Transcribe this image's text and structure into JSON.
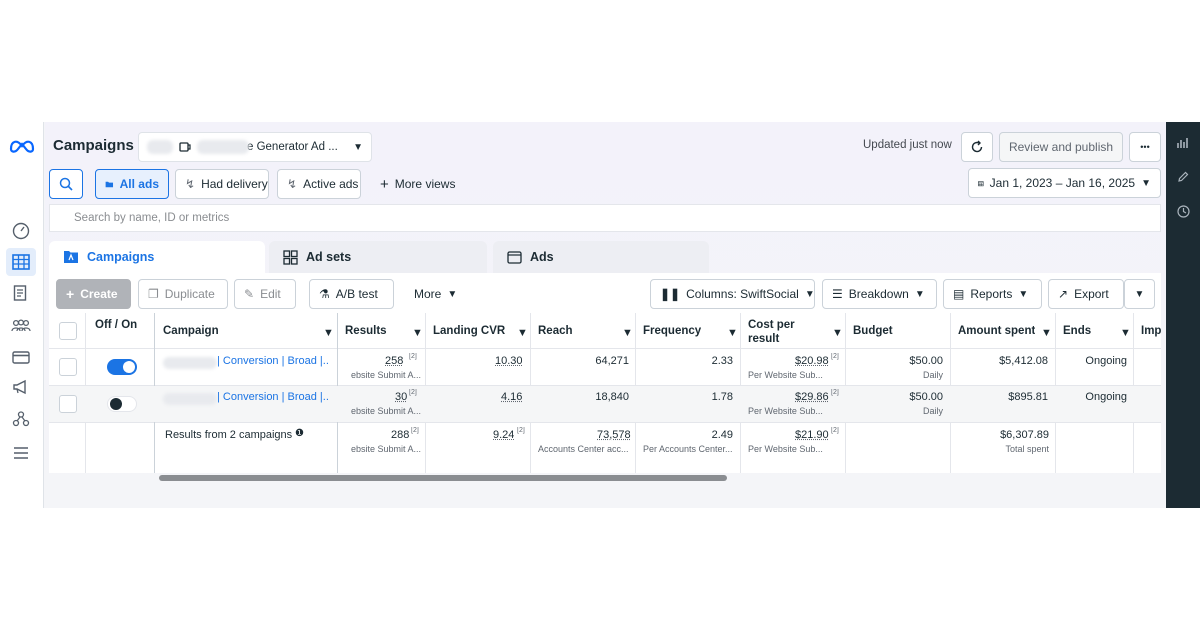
{
  "header": {
    "title": "Campaigns",
    "account_label": "e Generator Ad ...",
    "updated": "Updated just now",
    "review_publish": "Review and publish",
    "more": "•••"
  },
  "filters": {
    "all_ads": "All ads",
    "had_delivery": "Had delivery",
    "active_ads": "Active ads",
    "more_views": "More views",
    "date_range": "Jan 1, 2023 – Jan 16, 2025"
  },
  "search": {
    "placeholder": "Search by name, ID or metrics"
  },
  "level_tabs": [
    {
      "label": "Campaigns"
    },
    {
      "label": "Ad sets"
    },
    {
      "label": "Ads"
    }
  ],
  "toolbar": {
    "create": "Create",
    "duplicate": "Duplicate",
    "edit": "Edit",
    "ab_test": "A/B test",
    "more": "More",
    "columns": "Columns: SwiftSocial",
    "breakdown": "Breakdown",
    "reports": "Reports",
    "export": "Export"
  },
  "table": {
    "headers": {
      "offon": "Off / On",
      "campaign": "Campaign",
      "results": "Results",
      "landing_cvr": "Landing CVR",
      "reach": "Reach",
      "frequency": "Frequency",
      "cost_per_result": "Cost per result",
      "budget": "Budget",
      "amount_spent": "Amount spent",
      "ends": "Ends",
      "imp": "Imp"
    },
    "rows": [
      {
        "on": true,
        "campaign": "| Conversion | Broad |...",
        "results": "258",
        "results_note": "[2]",
        "results_sub": "ebsite Submit A...",
        "landing_cvr": "10.30",
        "reach": "64,271",
        "frequency": "2.33",
        "cost_per_result": "$20.98",
        "cost_note": "[2]",
        "cost_sub": "Per Website Sub...",
        "budget": "$50.00",
        "budget_sub": "Daily",
        "amount_spent": "$5,412.08",
        "ends": "Ongoing"
      },
      {
        "on": false,
        "campaign": "| Conversion | Broad |...",
        "results": "30",
        "results_note": "[2]",
        "results_sub": "ebsite Submit A...",
        "landing_cvr": "4.16",
        "reach": "18,840",
        "frequency": "1.78",
        "cost_per_result": "$29.86",
        "cost_note": "[2]",
        "cost_sub": "Per Website Sub...",
        "budget": "$50.00",
        "budget_sub": "Daily",
        "amount_spent": "$895.81",
        "ends": "Ongoing"
      }
    ],
    "summary": {
      "label": "Results from 2 campaigns",
      "results": "288",
      "results_note": "[2]",
      "results_sub": "ebsite Submit A...",
      "landing_cvr": "9.24",
      "landing_note": "[2]",
      "reach": "73,578",
      "reach_sub": "Accounts Center acc...",
      "frequency": "2.49",
      "frequency_sub": "Per Accounts Center...",
      "cost_per_result": "$21.90",
      "cost_note": "[2]",
      "cost_sub": "Per Website Sub...",
      "amount_spent": "$6,307.89",
      "amount_sub": "Total spent"
    }
  },
  "colors": {
    "accent": "#1b74e4",
    "rightbar": "#1c2b33"
  },
  "icons": {
    "logo": "meta-logo",
    "nav": [
      "dashboard-icon",
      "campaigns-grid-icon",
      "pages-icon",
      "audiences-icon",
      "billing-icon",
      "ads-megaphone-icon",
      "events-icon",
      "menu-icon"
    ],
    "right": [
      "chart-icon",
      "edit-icon",
      "clock-icon"
    ]
  }
}
